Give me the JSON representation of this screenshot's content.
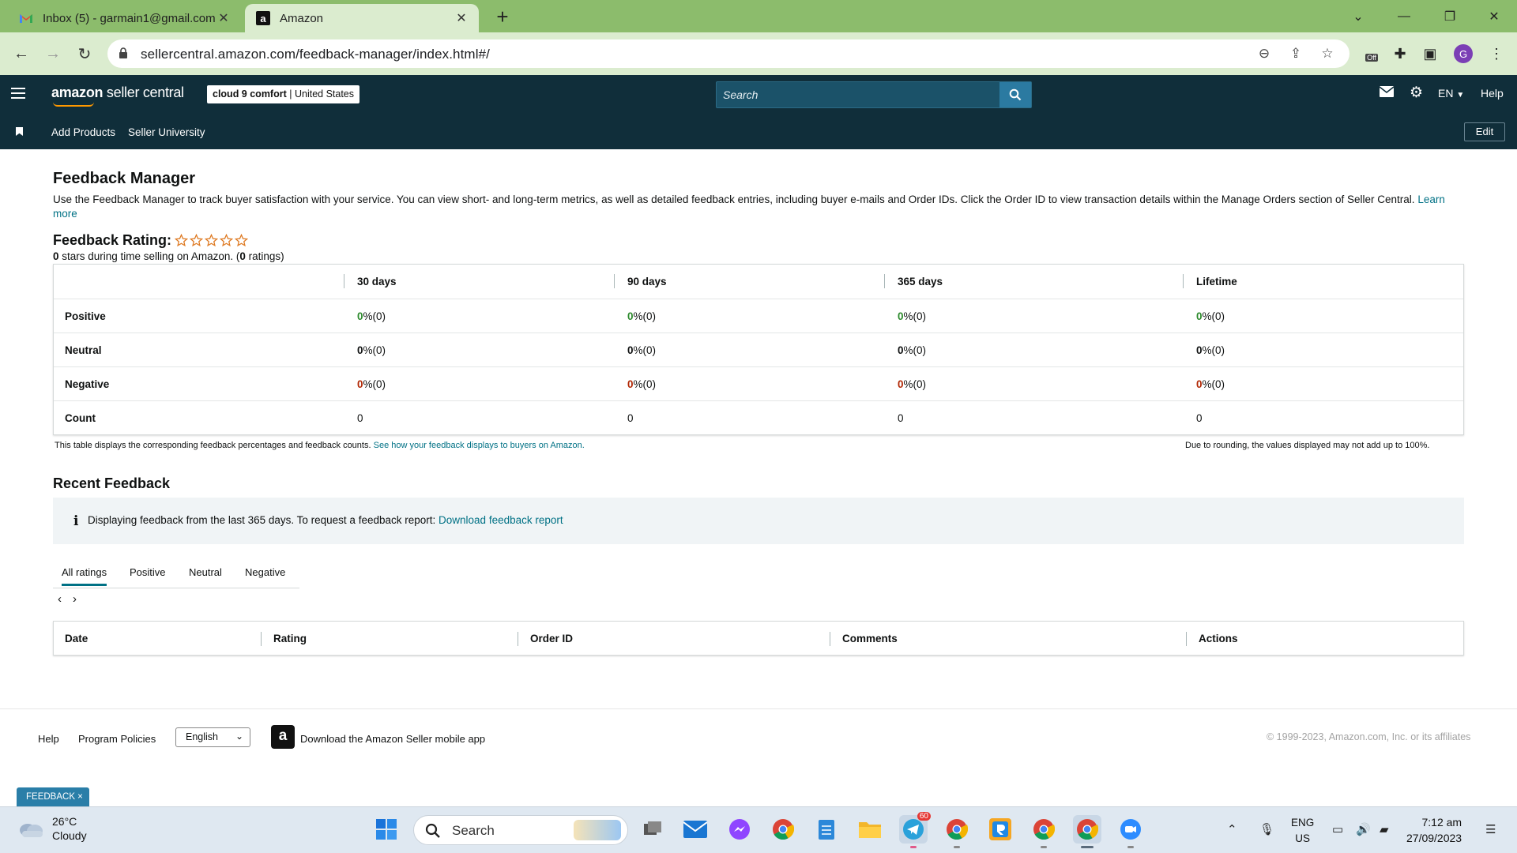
{
  "browser": {
    "tabs": [
      {
        "title": "Inbox (5) - garmain1@gmail.com",
        "icon": "gmail-icon"
      },
      {
        "title": "Amazon",
        "icon": "amazon-icon"
      }
    ],
    "url": "sellercentral.amazon.com/feedback-manager/index.html#/",
    "profile_initial": "G",
    "extension_badge": "Off"
  },
  "header": {
    "logo_bold": "amazon",
    "logo_rest": " seller central",
    "store_name": "cloud 9 comfort",
    "store_region": "| United States",
    "search_placeholder": "Search",
    "language": "EN",
    "help": "Help"
  },
  "subnav": {
    "items": [
      "Add Products",
      "Seller University"
    ],
    "edit": "Edit"
  },
  "page": {
    "title": "Feedback Manager",
    "intro": "Use the Feedback Manager to track buyer satisfaction with your service. You can view short- and long-term metrics, as well as detailed feedback entries, including buyer e-mails and Order IDs. Click the Order ID to view transaction details within the Manage Orders section of Seller Central.",
    "learn_more": "Learn more",
    "rating_label": "Feedback Rating:",
    "rating_stars": 0,
    "rating_summary_value": "0",
    "rating_summary_mid": " stars during time selling on Amazon. (",
    "rating_count": "0",
    "rating_summary_end": " ratings)"
  },
  "feedback_table": {
    "columns": [
      "",
      "30 days",
      "90 days",
      "365 days",
      "Lifetime"
    ],
    "rows": [
      {
        "label": "Positive",
        "values": [
          "0",
          "0",
          "0",
          "0"
        ],
        "suffix": " %(0)"
      },
      {
        "label": "Neutral",
        "values": [
          "0",
          "0",
          "0",
          "0"
        ],
        "suffix": " %(0)"
      },
      {
        "label": "Negative",
        "values": [
          "0",
          "0",
          "0",
          "0"
        ],
        "suffix": " %(0)"
      },
      {
        "label": "Count",
        "values": [
          "0",
          "0",
          "0",
          "0"
        ],
        "suffix": ""
      }
    ],
    "note_left": "This table displays the corresponding feedback percentages and feedback counts.",
    "note_link": "See how your feedback displays to buyers on Amazon.",
    "note_right": "Due to rounding, the values displayed may not add up to 100%."
  },
  "recent": {
    "title": "Recent Feedback",
    "info": "Displaying feedback from the last 365 days. To request a feedback report:",
    "info_link": "Download feedback report",
    "tabs": [
      "All ratings",
      "Positive",
      "Neutral",
      "Negative"
    ],
    "selected_tab": "All ratings",
    "columns": [
      "Date",
      "Rating",
      "Order ID",
      "Comments",
      "Actions"
    ]
  },
  "footer": {
    "help": "Help",
    "policies": "Program Policies",
    "language": "English",
    "app": "Download the Amazon Seller mobile app",
    "copyright": "© 1999-2023, Amazon.com, Inc. or its affiliates"
  },
  "feedback_tag": "FEEDBACK ×",
  "taskbar": {
    "temp": "26°C",
    "condition": "Cloudy",
    "search": "Search",
    "telegram_badge": "60",
    "lang_line1": "ENG",
    "lang_line2": "US",
    "time": "7:12 am",
    "date": "27/09/2023"
  },
  "colors": {
    "header_bg": "#102e3a",
    "tab_strip": "#8cbc6c",
    "link": "#007185",
    "positive": "#2c8a2c",
    "negative": "#b12704"
  }
}
